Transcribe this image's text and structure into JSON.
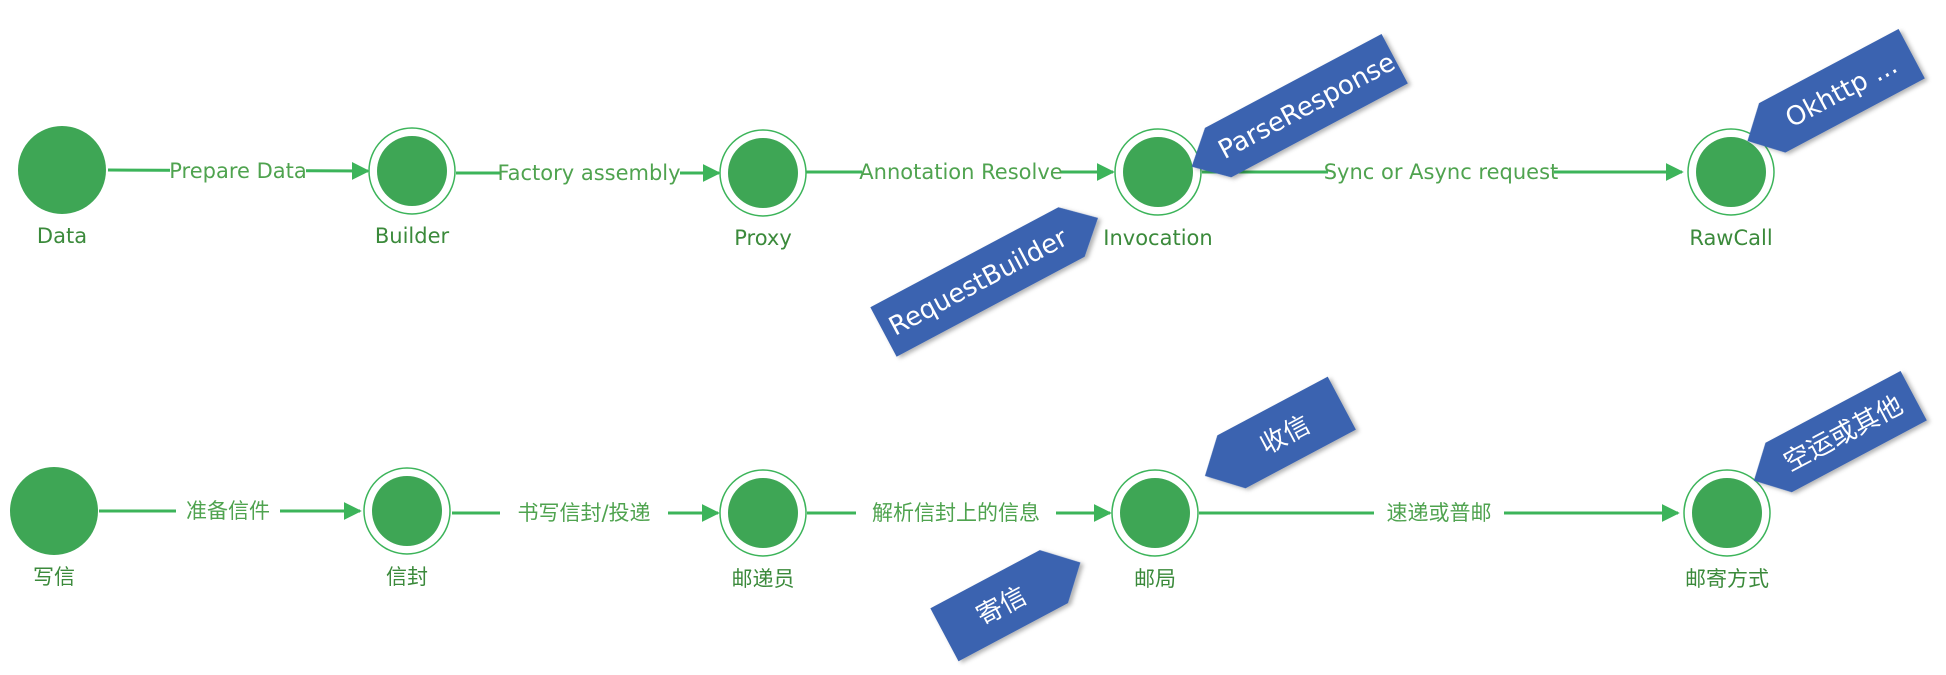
{
  "colors": {
    "edge": "#3cb45a",
    "node_fill": "#3ea655",
    "node_ring": "#3cb45a",
    "edge_text": "#4fa34f",
    "node_text": "#3b8a3b",
    "tag_fill": "#3a63b0",
    "tag_text": "#ffffff"
  },
  "rows": [
    {
      "nodes": [
        "Data",
        "Builder",
        "Proxy",
        "Invocation",
        "RawCall"
      ],
      "edges": [
        "Prepare Data",
        "Factory assembly",
        "Annotation Resolve",
        "Sync or Async request"
      ],
      "tags": [
        "ParseResponse",
        "RequestBuilder",
        "Okhttp ..."
      ]
    },
    {
      "nodes": [
        "写信",
        "信封",
        "邮递员",
        "邮局",
        "邮寄方式"
      ],
      "edges": [
        "准备信件",
        "书写信封/投递",
        "解析信封上的信息",
        "速递或普邮"
      ],
      "tags": [
        "收信",
        "寄信",
        "空运或其他"
      ]
    }
  ]
}
